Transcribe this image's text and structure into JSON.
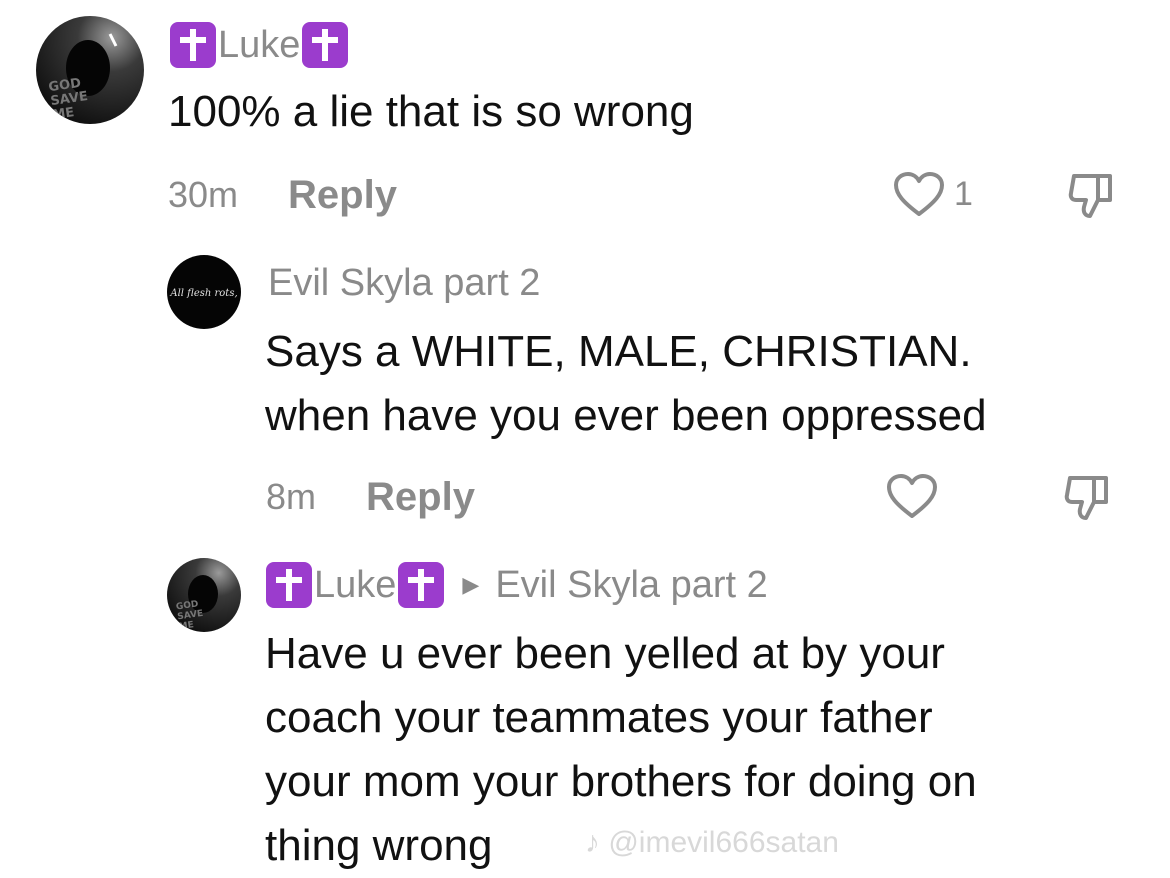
{
  "comments": [
    {
      "username": "Luke",
      "text_lines": [
        "100% a lie that is so wrong"
      ],
      "time": "30m",
      "reply_label": "Reply",
      "like_count": "1",
      "avatar_text": [
        "GOD",
        "SAVE",
        "ME"
      ]
    },
    {
      "username": "Evil Skyla part 2",
      "text_lines": [
        "Says a WHITE, MALE, CHRISTIAN.",
        "when have you ever been oppressed"
      ],
      "time": "8m",
      "reply_label": "Reply",
      "avatar_text": "All flesh rots,"
    },
    {
      "username": "Luke",
      "reply_to": "Evil Skyla part 2",
      "text_lines": [
        "Have u ever been yelled at by your",
        "coach your teammates your father",
        "your mom your brothers for doing on",
        "thing wrong"
      ],
      "avatar_text": [
        "GOD",
        "SAVE",
        "ME"
      ]
    }
  ],
  "watermark": "@imevil666satan",
  "colors": {
    "cross_badge": "#9b3ccd",
    "meta_gray": "#8a8a8a",
    "text": "#111111"
  }
}
